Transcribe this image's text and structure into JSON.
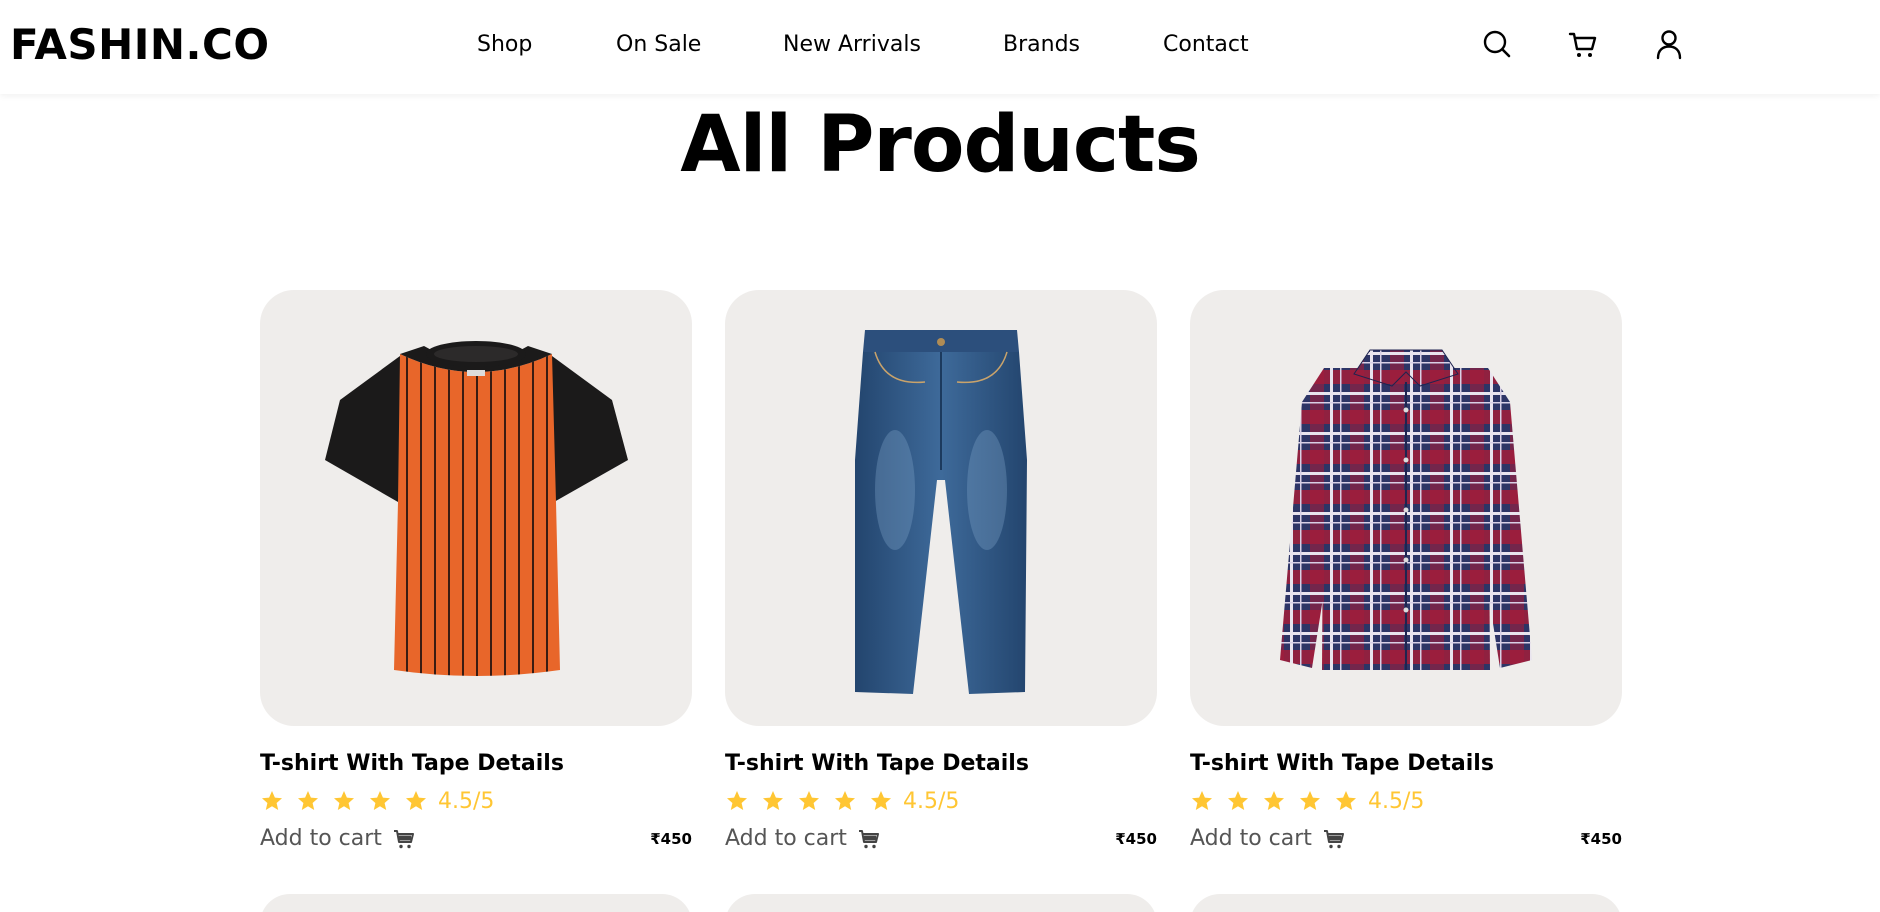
{
  "header": {
    "logo": "FASHIN.CO",
    "nav": [
      "Shop",
      "On Sale",
      "New Arrivals",
      "Brands",
      "Contact"
    ],
    "icons": [
      "search-icon",
      "cart-icon",
      "user-icon"
    ]
  },
  "main": {
    "title": "All Products"
  },
  "products": [
    {
      "name": "T-shirt With Tape Details",
      "rating": "4.5/5",
      "stars": 5,
      "add_to_cart": "Add to cart",
      "price": "₹450",
      "image": "orange-striped-raglan-tshirt"
    },
    {
      "name": "T-shirt With Tape Details",
      "rating": "4.5/5",
      "stars": 5,
      "add_to_cart": "Add to cart",
      "price": "₹450",
      "image": "blue-denim-jeans"
    },
    {
      "name": "T-shirt With Tape Details",
      "rating": "4.5/5",
      "stars": 5,
      "add_to_cart": "Add to cart",
      "price": "₹450",
      "image": "red-blue-plaid-shirt"
    }
  ],
  "colors": {
    "card_bg": "#efedeb",
    "star": "#ffc633",
    "text": "#000000",
    "muted": "#555555"
  }
}
